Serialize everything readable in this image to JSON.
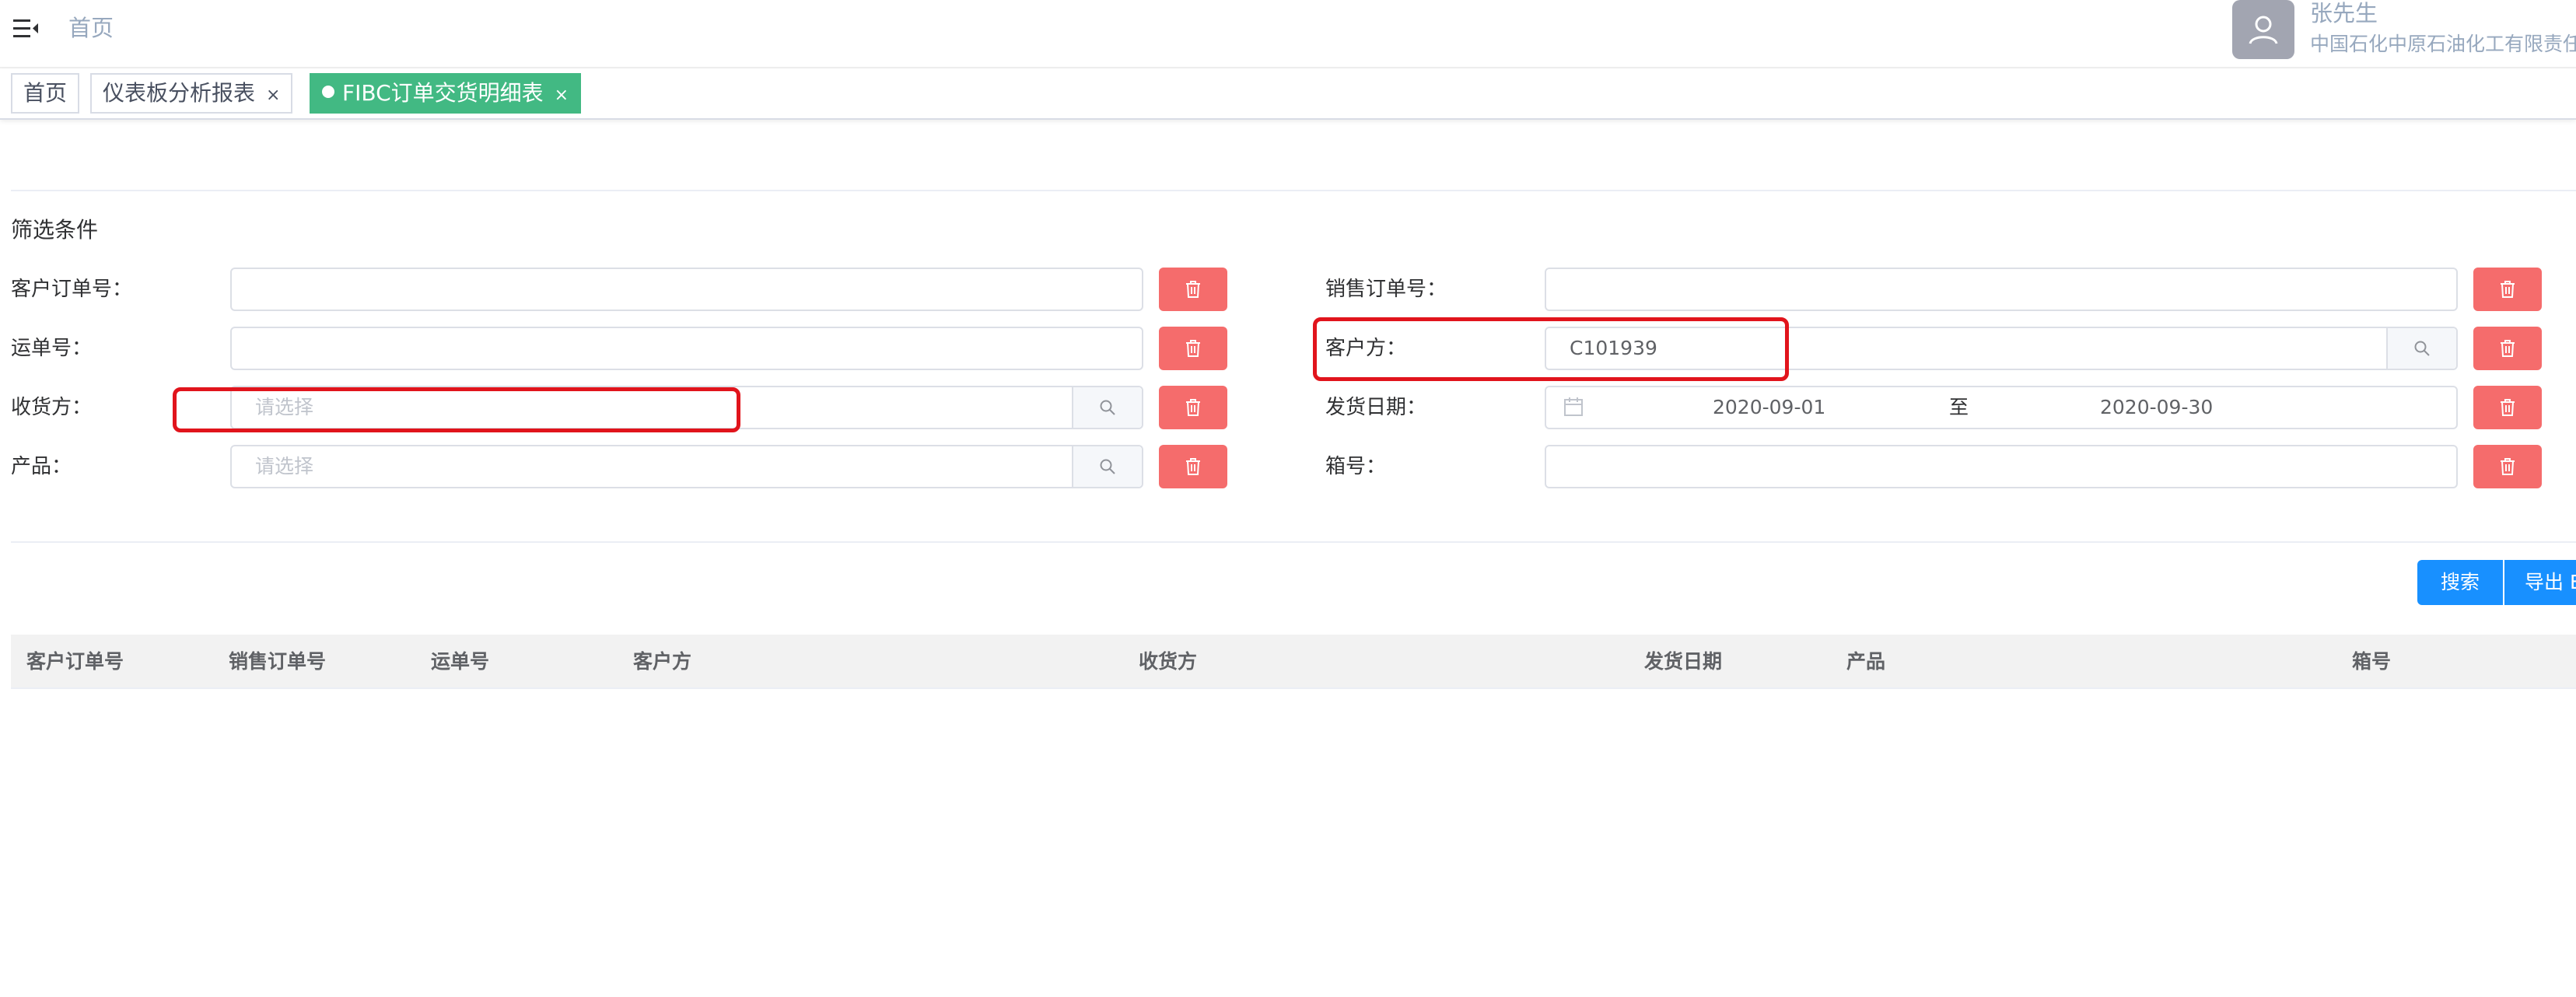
{
  "navbar": {
    "breadcrumb_home": "首页",
    "user_name": "张先生",
    "user_company": "中国石化中原石油化工有限责任公"
  },
  "tags": [
    {
      "label": "首页",
      "active": false
    },
    {
      "label": "仪表板分析报表",
      "active": false,
      "close": "×"
    },
    {
      "label": "FIBC订单交货明细表",
      "active": true,
      "close": "×"
    }
  ],
  "filter": {
    "title": "筛选条件",
    "customer_order_no": {
      "label": "客户订单号：",
      "value": ""
    },
    "sales_order_no": {
      "label": "销售订单号：",
      "value": ""
    },
    "waybill_no": {
      "label": "运单号：",
      "value": ""
    },
    "customer": {
      "label": "客户方：",
      "value": "C101939"
    },
    "consignee": {
      "label": "收货方：",
      "placeholder": "请选择"
    },
    "ship_date": {
      "label": "发货日期：",
      "start": "2020-09-01",
      "separator": "至",
      "end": "2020-09-30"
    },
    "product": {
      "label": "产品：",
      "placeholder": "请选择"
    },
    "box_no": {
      "label": "箱号：",
      "value": ""
    }
  },
  "actions": {
    "search": "搜索",
    "export": "导出 E"
  },
  "table": {
    "columns": [
      "客户订单号",
      "销售订单号",
      "运单号",
      "客户方",
      "收货方",
      "发货日期",
      "产品",
      "箱号"
    ]
  },
  "colors": {
    "tag_active": "#42b983",
    "delete_button": "#f56c6c",
    "primary_button": "#1890ff",
    "highlight_box": "#e1141c"
  }
}
